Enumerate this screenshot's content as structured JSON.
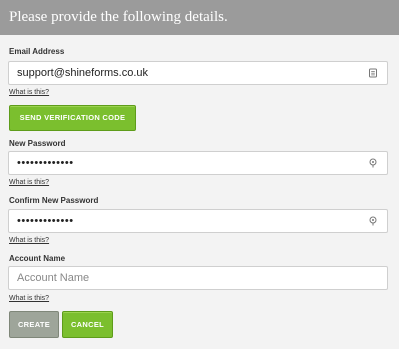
{
  "header": {
    "title": "Please provide the following details."
  },
  "email": {
    "label": "Email Address",
    "value": "support@shineforms.co.uk",
    "help": "What is this?"
  },
  "send_code_button": "SEND VERIFICATION CODE",
  "new_password": {
    "label": "New Password",
    "value": "•••••••••••••",
    "help": "What is this?"
  },
  "confirm_password": {
    "label": "Confirm New Password",
    "value": "•••••••••••••",
    "help": "What is this?"
  },
  "account_name": {
    "label": "Account Name",
    "placeholder": "Account Name",
    "help": "What is this?"
  },
  "buttons": {
    "create": "CREATE",
    "cancel": "CANCEL"
  },
  "colors": {
    "header": "#9b9b9b",
    "accent": "#7bbf2e",
    "create": "#9ea59a"
  }
}
